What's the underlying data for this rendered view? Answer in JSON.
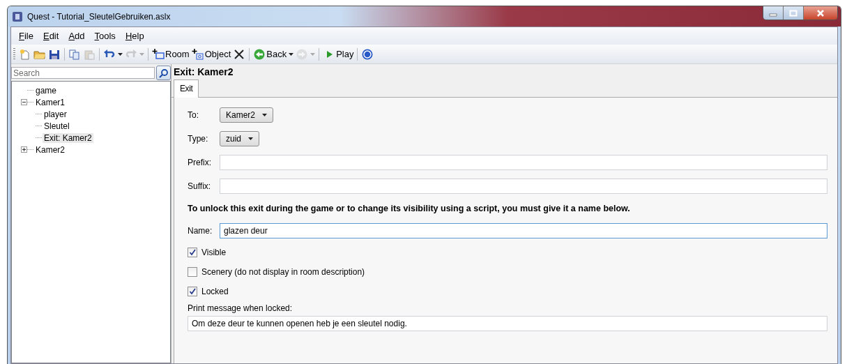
{
  "window": {
    "title": "Quest - Tutorial_SleutelGebruiken.aslx"
  },
  "menu": [
    "File",
    "Edit",
    "Add",
    "Tools",
    "Help"
  ],
  "toolbar": [
    {
      "kind": "icon",
      "disabled": false
    },
    {
      "kind": "icon",
      "disabled": false
    },
    {
      "kind": "icon",
      "disabled": false
    },
    {
      "kind": "separator"
    },
    {
      "kind": "icon",
      "disabled": false
    },
    {
      "kind": "icon",
      "disabled": true
    },
    {
      "kind": "separator"
    },
    {
      "kind": "icon",
      "disabled": false
    },
    {
      "kind": "caret",
      "disabled": false
    },
    {
      "kind": "icon",
      "disabled": true
    },
    {
      "kind": "caret",
      "disabled": true
    },
    {
      "kind": "separator"
    },
    {
      "kind": "button",
      "label": "Room",
      "disabled": false
    },
    {
      "kind": "button",
      "label": "Object",
      "disabled": false
    },
    {
      "kind": "icon",
      "disabled": false
    },
    {
      "kind": "separator"
    },
    {
      "kind": "button",
      "label": "Back",
      "disabled": false
    },
    {
      "kind": "caret",
      "disabled": false
    },
    {
      "kind": "icon",
      "disabled": true
    },
    {
      "kind": "caret",
      "disabled": true
    },
    {
      "kind": "separator"
    },
    {
      "kind": "button",
      "label": "Play",
      "disabled": false
    },
    {
      "kind": "separator"
    },
    {
      "kind": "icon",
      "disabled": false
    }
  ],
  "search": {
    "placeholder": "Search"
  },
  "tree": [
    {
      "label": "game",
      "selected": false
    },
    {
      "label": "Kamer1",
      "selected": false,
      "expanded": true,
      "children": [
        {
          "label": "player",
          "selected": false
        },
        {
          "label": "Sleutel",
          "selected": false
        },
        {
          "label": "Exit: Kamer2",
          "selected": true
        }
      ]
    },
    {
      "label": "Kamer2",
      "selected": false,
      "expanded": false
    }
  ],
  "editor": {
    "title": "Exit: Kamer2",
    "tabs": [
      {
        "label": "Exit",
        "selected": true
      }
    ],
    "fields": [
      {
        "kind": "dropdown",
        "label": "To:",
        "value": "Kamer2"
      },
      {
        "kind": "dropdown",
        "label": "Type:",
        "value": "zuid"
      },
      {
        "kind": "text",
        "label": "Prefix:"
      },
      {
        "kind": "text",
        "label": "Suffix:"
      },
      {
        "kind": "note",
        "text": "To unlock this exit during the game or to change its visibility using a script, you must give it a name below."
      },
      {
        "kind": "text",
        "label": "Name:",
        "value": "glazen deur",
        "focused": true
      },
      {
        "kind": "checkbox",
        "label": "Visible",
        "checked": true
      },
      {
        "kind": "checkbox",
        "label": "Scenery (do not display in room description)",
        "checked": false
      },
      {
        "kind": "checkbox",
        "label": "Locked",
        "checked": true
      },
      {
        "kind": "caption",
        "text": "Print message when locked:"
      },
      {
        "kind": "wide",
        "value": "Om deze deur te kunnen openen heb je een sleutel nodig."
      }
    ]
  }
}
